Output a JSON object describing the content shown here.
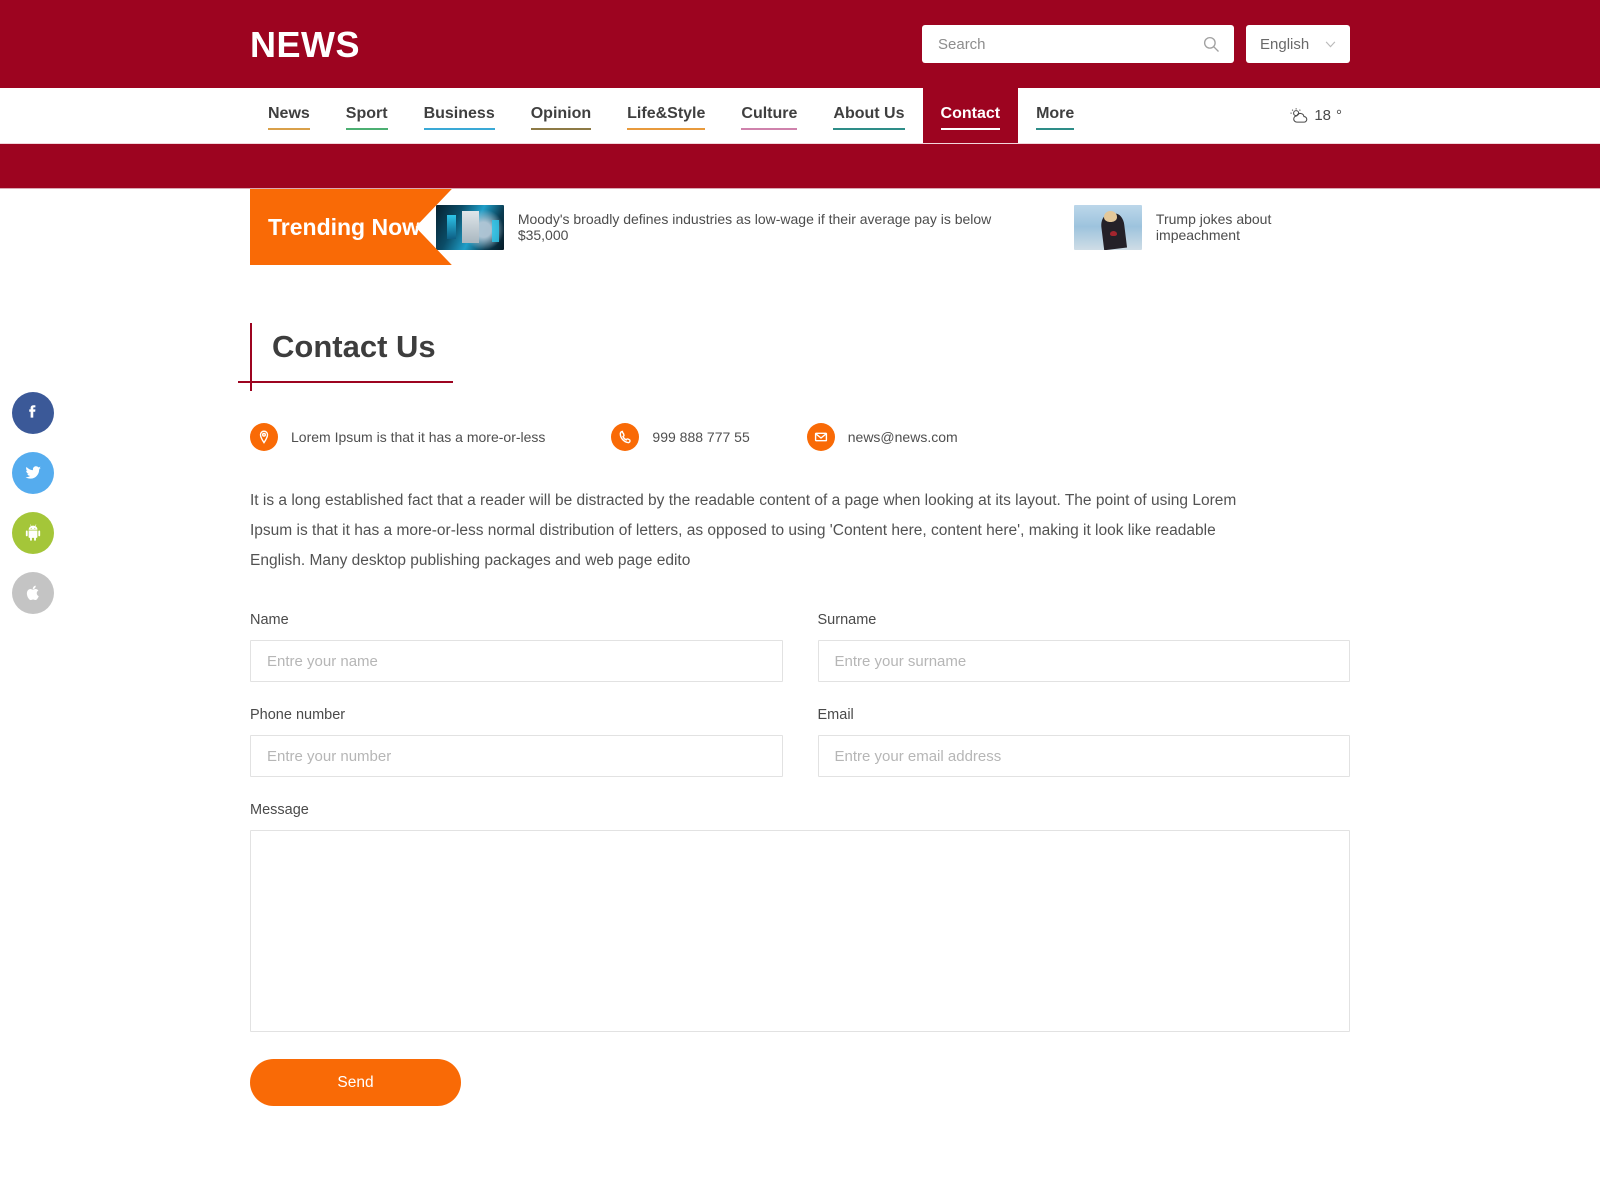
{
  "header": {
    "logo": "NEWS",
    "search": {
      "placeholder": "Search",
      "value": "",
      "icon": "search-icon"
    },
    "language": {
      "selected": "English",
      "icon": "chevron-down-icon"
    },
    "bg_color": "#9d0420"
  },
  "nav": {
    "items": [
      {
        "label": "News",
        "underline": "#d9a04a",
        "active": false
      },
      {
        "label": "Sport",
        "underline": "#4caf72",
        "active": false
      },
      {
        "label": "Business",
        "underline": "#3aa9d6",
        "active": false
      },
      {
        "label": "Opinion",
        "underline": "#8d7a45",
        "active": false
      },
      {
        "label": "Life&Style",
        "underline": "#e89a3c",
        "active": false
      },
      {
        "label": "Culture",
        "underline": "#cf82ac",
        "active": false
      },
      {
        "label": "About Us",
        "underline": "#2e8d88",
        "active": false
      },
      {
        "label": "Contact",
        "underline": "#ffffff",
        "active": true
      },
      {
        "label": "More",
        "underline": "#2e8d88",
        "active": false
      }
    ],
    "weather": {
      "temperature": "18",
      "degree": "°",
      "icon": "sun-behind-cloud-icon"
    }
  },
  "trending": {
    "tag": "Trending Now",
    "tag_color": "#f96a06",
    "items": [
      {
        "title": "Moody's broadly defines industries as low-wage if their average pay is below $35,000",
        "thumb": "tech-servers-image"
      },
      {
        "title": "Trump jokes about impeachment",
        "thumb": "trump-portrait-image"
      }
    ]
  },
  "social": [
    {
      "name": "facebook",
      "color": "#3b5998"
    },
    {
      "name": "twitter",
      "color": "#55acee"
    },
    {
      "name": "android",
      "color": "#a4c639"
    },
    {
      "name": "apple",
      "color": "#c4c4c4"
    }
  ],
  "page": {
    "title": "Contact Us",
    "accent_color": "#9d0420",
    "meta": [
      {
        "icon": "location-pin-icon",
        "text": "Lorem Ipsum is that it has a more-or-less"
      },
      {
        "icon": "phone-icon",
        "text": "999 888 777 55"
      },
      {
        "icon": "envelope-icon",
        "text": "news@news.com"
      }
    ],
    "lead": "It is a long established fact that a reader will be distracted by the readable content of a page when looking at its layout. The point of using Lorem Ipsum is that it has a more-or-less normal distribution of letters, as opposed to using 'Content here, content here', making it look like readable English. Many desktop publishing packages and web page edito"
  },
  "form": {
    "name": {
      "label": "Name",
      "placeholder": "Entre your name",
      "value": ""
    },
    "surname": {
      "label": "Surname",
      "placeholder": "Entre your surname",
      "value": ""
    },
    "phone": {
      "label": "Phone number",
      "placeholder": "Entre your number",
      "value": ""
    },
    "email": {
      "label": "Email",
      "placeholder": "Entre your email address",
      "value": ""
    },
    "message": {
      "label": "Message",
      "placeholder": "",
      "value": ""
    },
    "submit": {
      "label": "Send",
      "color": "#f96a06"
    }
  }
}
